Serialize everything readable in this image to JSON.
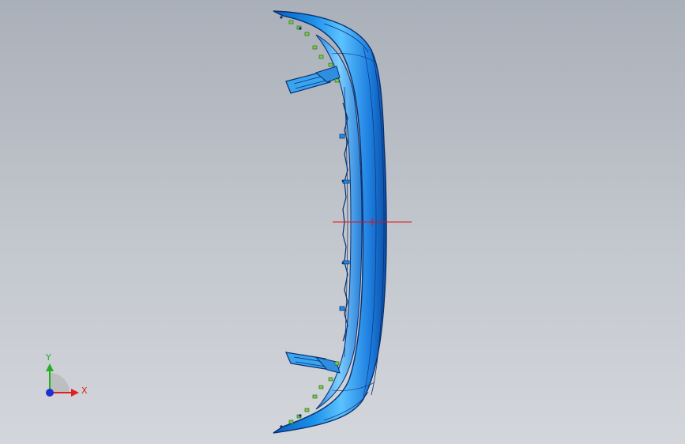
{
  "viewport": {
    "background_top": "#aab0b9",
    "background_bottom": "#d3d6db"
  },
  "model": {
    "part": "bumper",
    "body_color": "#1a8fe8",
    "edge_color": "#0a2f6e",
    "highlight_color": "#7fd0ff",
    "clip_color": "#6fd04a"
  },
  "origin_marker": {
    "color": "#e01010"
  },
  "triad": {
    "x_label": "X",
    "y_label": "Y",
    "x_color": "#e02020",
    "y_color": "#22b022",
    "z_color": "#2030d0"
  }
}
